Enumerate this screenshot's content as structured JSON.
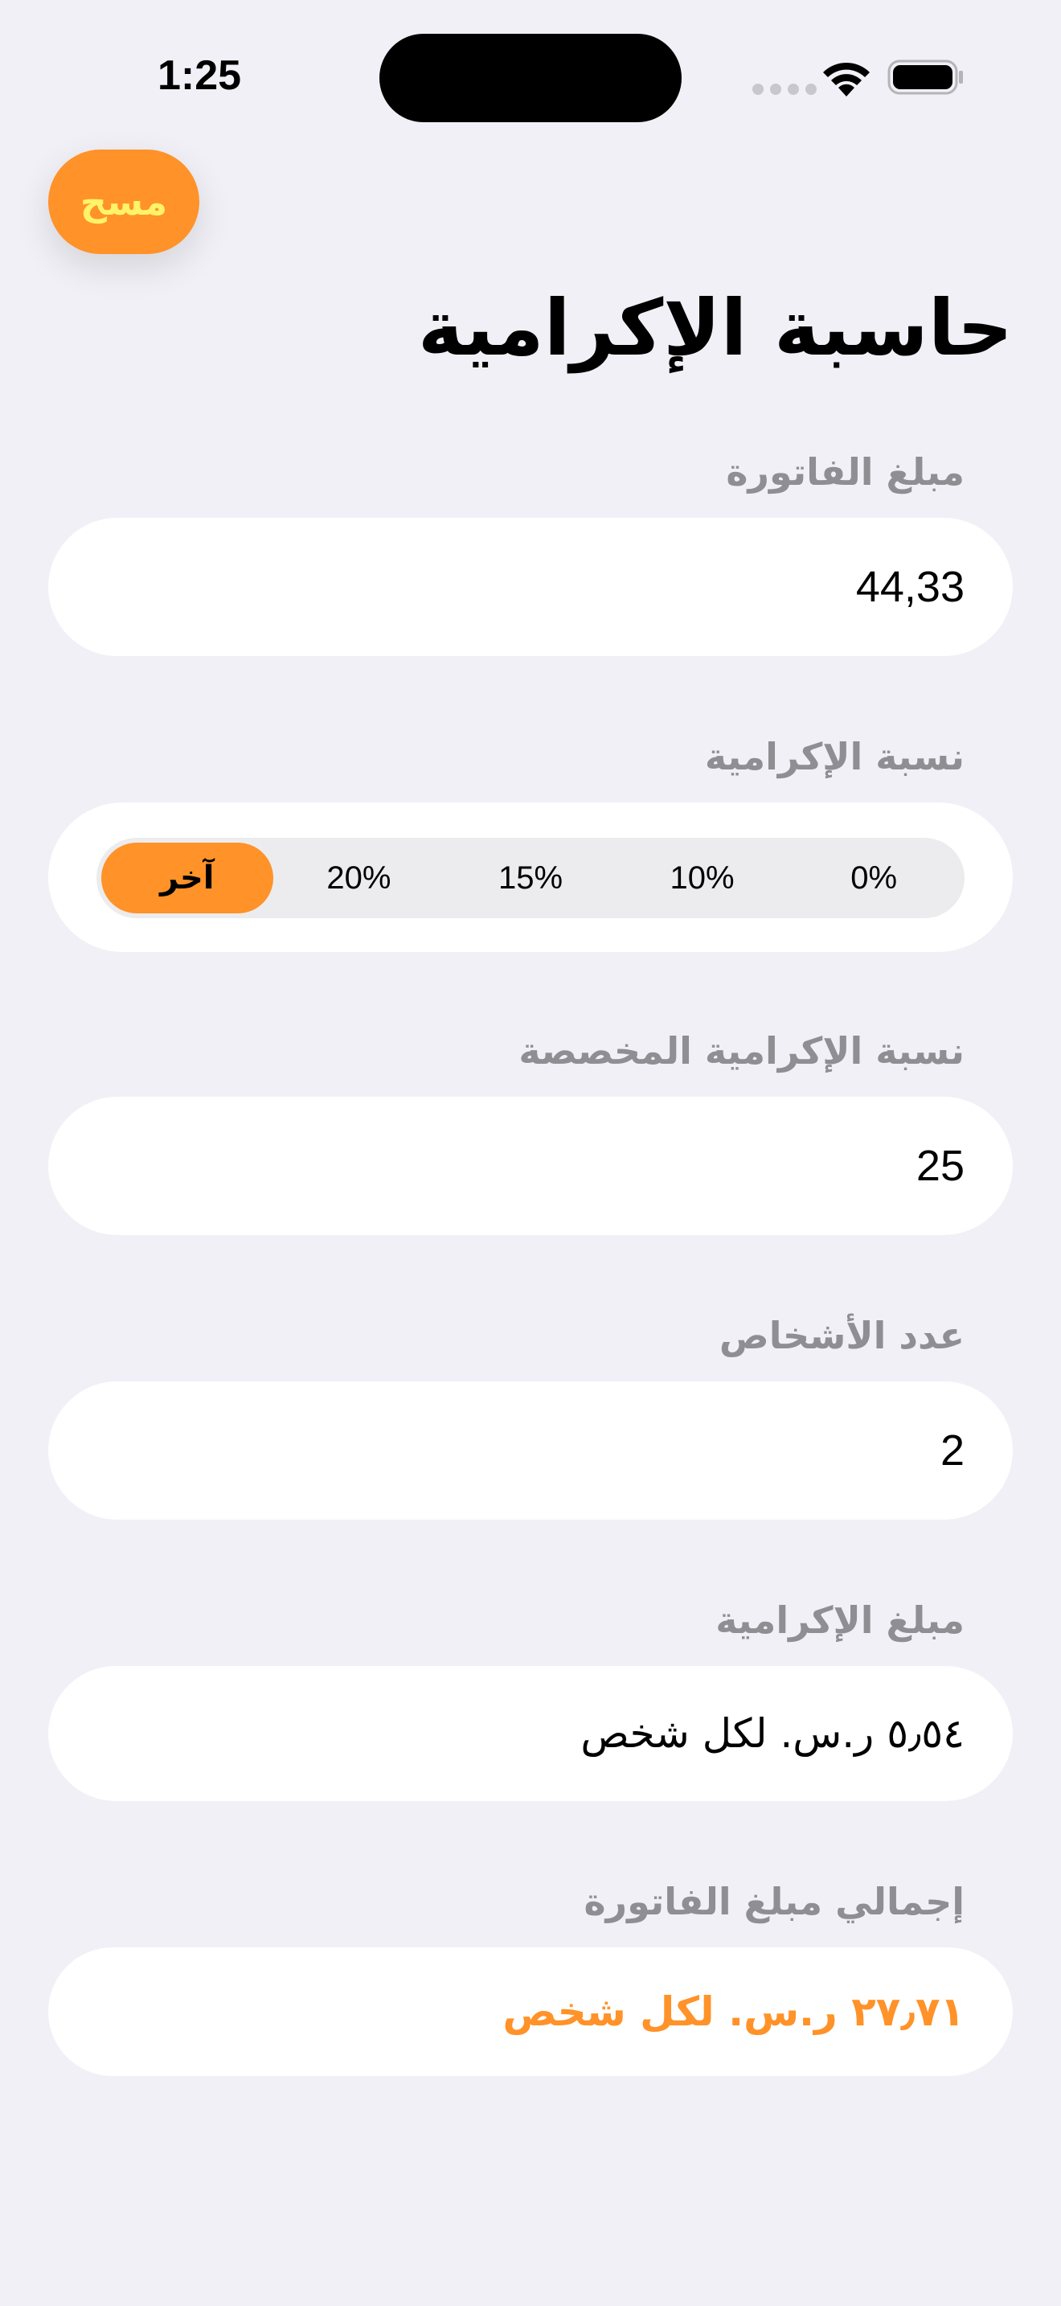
{
  "status_bar": {
    "time": "1:25"
  },
  "toolbar": {
    "clear_label": "مسح"
  },
  "page": {
    "title": "حاسبة الإكرامية"
  },
  "bill": {
    "label": "مبلغ الفاتورة",
    "value": "44,33"
  },
  "tip_percent": {
    "label": "نسبة الإكرامية",
    "options": [
      "آخر",
      "20%",
      "15%",
      "10%",
      "0%"
    ],
    "selected": "آخر"
  },
  "custom_tip": {
    "label": "نسبة الإكرامية المخصصة",
    "value": "25"
  },
  "people": {
    "label": "عدد الأشخاص",
    "value": "2"
  },
  "tip_amount": {
    "label": "مبلغ الإكرامية",
    "value": "٥٫٥٤ ر.س. لكل شخص"
  },
  "total": {
    "label": "إجمالي مبلغ الفاتورة",
    "value": "٢٧٫٧١ ر.س. لكل شخص"
  },
  "colors": {
    "accent": "#ff9228",
    "clear_text": "#fff36b",
    "background": "#f1f0f6",
    "label_gray": "#8e8e93"
  },
  "icons": [
    "cellular-signal-icon",
    "wifi-icon",
    "battery-icon"
  ]
}
